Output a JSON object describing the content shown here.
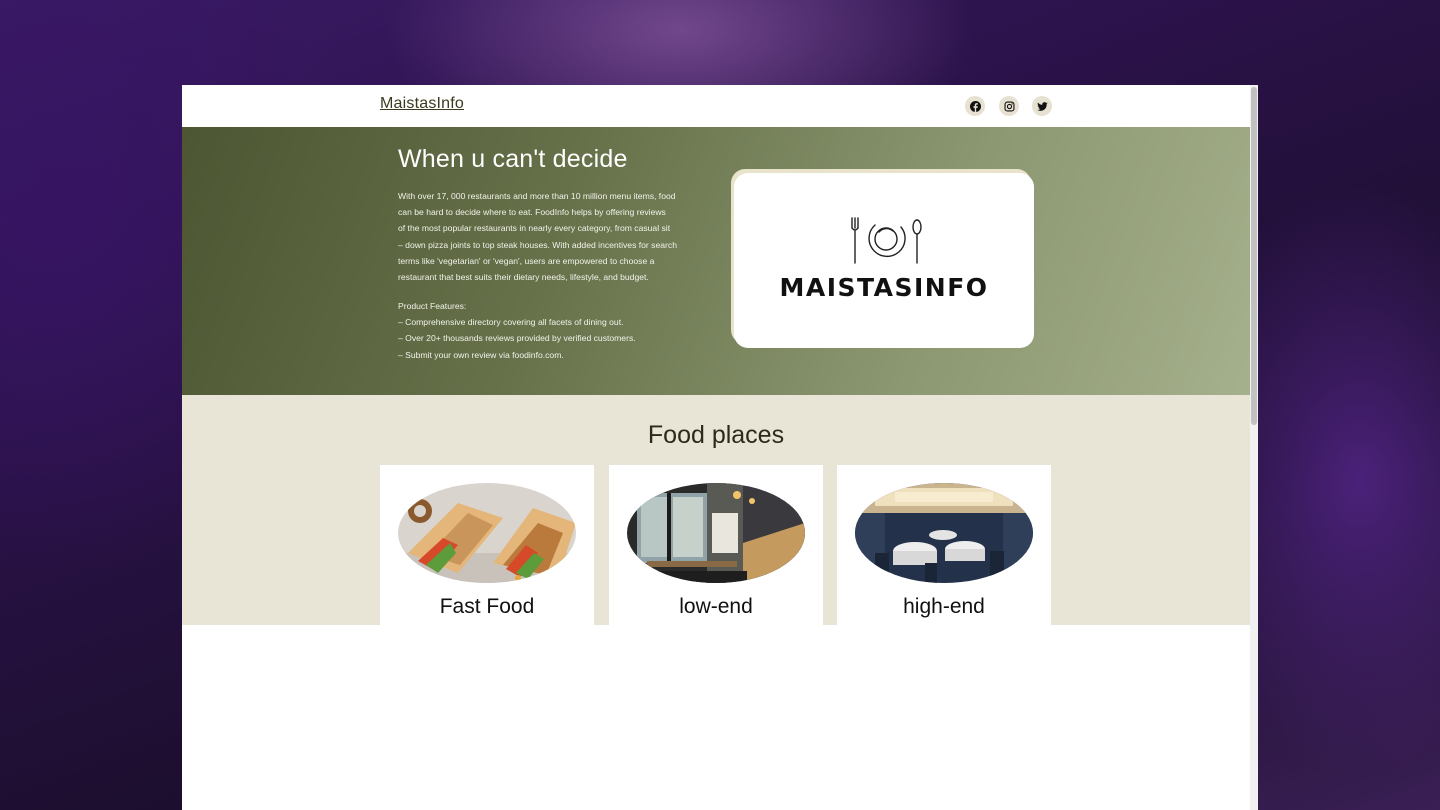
{
  "navbar": {
    "brand": "MaistasInfo",
    "social_icons": [
      "facebook-icon",
      "instagram-icon",
      "twitter-icon"
    ]
  },
  "hero": {
    "title": "When u can't decide",
    "body": "With over 17, 000 restaurants and more than 10 million menu items, food\ncan be hard to decide where to eat. FoodInfo helps by offering reviews\nof the most popular restaurants in nearly every category, from casual sit\n– down pizza joints to top steak houses. With added incentives for search\nterms like 'vegetarian' or 'vegan', users are empowered to choose a\nrestaurant that best suits their dietary needs, lifestyle, and budget.",
    "features_heading": "Product Features:",
    "features": [
      "– Comprehensive directory covering all facets of dining out.",
      "– Over 20+ thousands reviews provided by verified customers.",
      "– Submit your own review via foodinfo.com."
    ],
    "logo_text": "MAISTASINFO"
  },
  "places": {
    "title": "Food places",
    "cards": [
      {
        "label": "Fast Food"
      },
      {
        "label": "low-end"
      },
      {
        "label": "high-end"
      }
    ]
  },
  "colors": {
    "hero_start": "#4c5632",
    "hero_end": "#a5b08c",
    "places_bg": "#e8e4d6",
    "social_bg": "#e6e1d0"
  }
}
